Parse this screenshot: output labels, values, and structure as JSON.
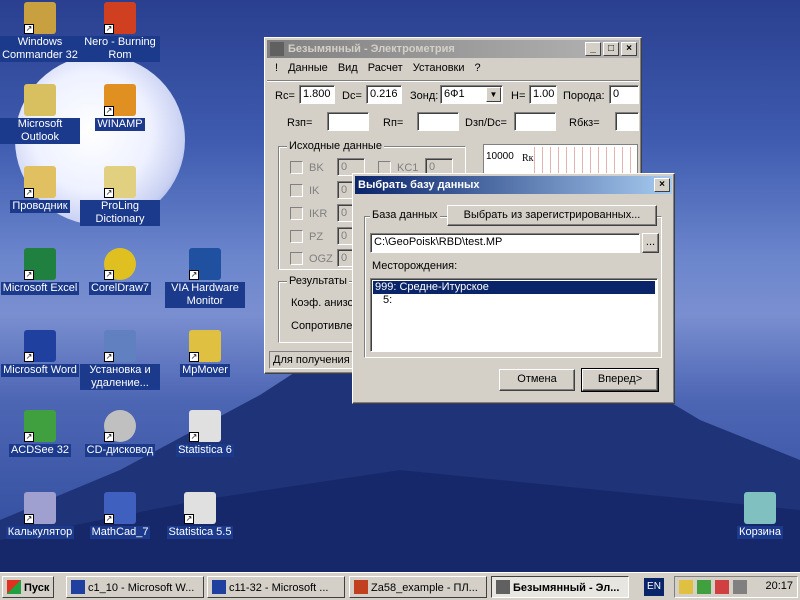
{
  "desktop": {
    "icons": [
      {
        "label": "Windows Commander 32",
        "color": "#c8a040"
      },
      {
        "label": "Nero - Burning Rom",
        "color": "#d04020"
      },
      {
        "label": "Microsoft Outlook",
        "color": "#d8c060"
      },
      {
        "label": "WINAMP",
        "color": "#e09020"
      },
      {
        "label": "Проводник",
        "color": "#e0c060"
      },
      {
        "label": "ProLing Dictionary",
        "color": "#e0d080"
      },
      {
        "label": "Microsoft Excel",
        "color": "#208040"
      },
      {
        "label": "CorelDraw7",
        "color": "#e0c020"
      },
      {
        "label": "VIA Hardware Monitor",
        "color": "#2050a0"
      },
      {
        "label": "Microsoft Word",
        "color": "#2040a0"
      },
      {
        "label": "Установка и удаление...",
        "color": "#6080c0"
      },
      {
        "label": "MpMover",
        "color": "#e0c040"
      },
      {
        "label": "ACDSee 32",
        "color": "#40a040"
      },
      {
        "label": "CD-дисковод",
        "color": "#c0c0c0"
      },
      {
        "label": "Statistica 6",
        "color": "#e0e0e0"
      },
      {
        "label": "Калькулятор",
        "color": "#a0a0d0"
      },
      {
        "label": "MathCad_7",
        "color": "#4060c0"
      },
      {
        "label": "Statistica 5.5",
        "color": "#e0e0e0"
      },
      {
        "label": "Корзина",
        "color": "#80c0c0"
      }
    ]
  },
  "main_window": {
    "title": "Безымянный - Электрометрия",
    "menu": [
      "!",
      "Данные",
      "Вид",
      "Расчет",
      "Установки",
      "?"
    ],
    "row1": {
      "rc_label": "Rc=",
      "rc_value": "1.800",
      "dc_label": "Dc=",
      "dc_value": "0.216",
      "zond_label": "Зонд:",
      "zond_value": "6Ф1",
      "h_label": "H=",
      "h_value": "1.00",
      "poroda_label": "Порода:",
      "poroda_value": "0"
    },
    "row2": {
      "rzp_label": "Rзп=",
      "rp_label": "Rп=",
      "dzp_label": "Dзп/Dc=",
      "rbkz_label": "Rбкз="
    },
    "source_group": "Исходные данные",
    "checks": [
      {
        "label": "BK",
        "value": "0"
      },
      {
        "label": "IK",
        "value": "0"
      },
      {
        "label": "IKR",
        "value": "0"
      },
      {
        "label": "PZ",
        "value": "0"
      },
      {
        "label": "OGZ",
        "value": "0"
      }
    ],
    "check_kc1": {
      "label": "KC1",
      "value": "0"
    },
    "results_group": "Результаты",
    "result_line1": "Коэф. анизо",
    "result_line2": "Сопротивле",
    "chart_top_value": "10000",
    "chart_series": "Rк",
    "status": "Для получения"
  },
  "dialog": {
    "title": "Выбрать базу данных",
    "db_group": "База данных",
    "choose_registered": "Выбрать из зарегистрированных...",
    "path": "C:\\GeoPoisk\\RBD\\test.MP",
    "browse": "...",
    "deposits_label": "Месторождения:",
    "deposits": [
      "999: Средне-Итурское",
      "5:"
    ],
    "cancel": "Отмена",
    "next": "Вперед>"
  },
  "taskbar": {
    "start": "Пуск",
    "tasks": [
      {
        "label": "c1_10 - Microsoft W...",
        "icon_color": "#2040a0"
      },
      {
        "label": "c11-32 - Microsoft ...",
        "icon_color": "#2040a0"
      },
      {
        "label": "Za58_example - ПЛ...",
        "icon_color": "#c04020"
      },
      {
        "label": "Безымянный - Эл...",
        "icon_color": "#606060"
      }
    ],
    "lang": "EN",
    "clock": "20:17"
  }
}
